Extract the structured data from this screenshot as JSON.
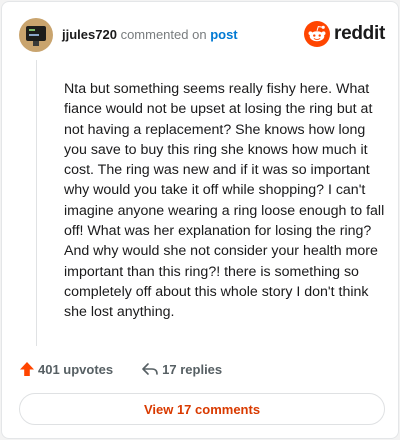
{
  "comment": {
    "username": "jjules720",
    "action_text": "commented on",
    "post_link_text": "post",
    "body": "Nta but something seems really fishy here. What fiance would not be upset at losing the ring but at not having a replacement? She knows how long you save to buy this ring she knows how much it cost. The ring was new and if it was so important why would you take it off while shopping? I can't imagine anyone wearing a ring loose enough to fall off! What was her explanation for losing the ring? And why would she not consider your health more important than this ring?! there is something so completely off about this whole story I don't think she lost anything.",
    "upvotes_label": "401 upvotes",
    "replies_label": "17 replies"
  },
  "brand": {
    "name": "reddit",
    "accent_color": "#ff4500"
  },
  "footer": {
    "view_comments_label": "View 17 comments"
  },
  "icons": {
    "avatar": "avatar-image",
    "logo": "reddit-snoo-icon",
    "upvote": "upvote-arrow-icon",
    "replies": "reply-arrow-icon"
  }
}
